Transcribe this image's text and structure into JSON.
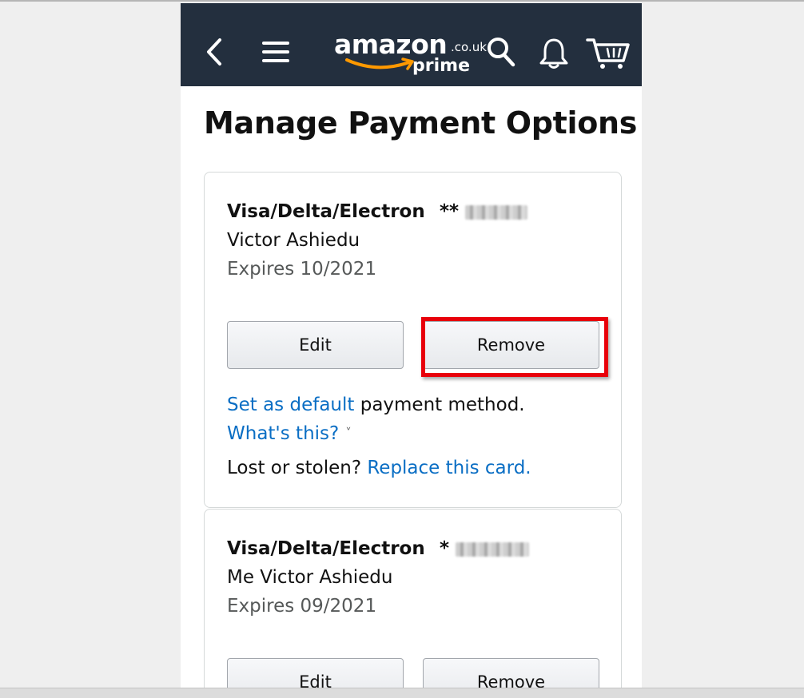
{
  "navbar": {
    "logo_word": "amazon",
    "logo_tld": ".co.uk",
    "logo_sub": "prime"
  },
  "page": {
    "title": "Manage Payment Options"
  },
  "cards": [
    {
      "type": "Visa/Delta/Electron",
      "mask": "**",
      "holder": "Victor Ashiedu",
      "expiry": "Expires 10/2021",
      "edit_label": "Edit",
      "remove_label": "Remove",
      "set_default_link": "Set as default",
      "set_default_rest": " payment method.",
      "whats_this_link": "What's this?",
      "lost_text": "Lost or stolen? ",
      "replace_link": "Replace this card."
    },
    {
      "type": "Visa/Delta/Electron",
      "mask": "*",
      "holder": "Me Victor Ashiedu",
      "expiry": "Expires 09/2021",
      "edit_label": "Edit",
      "remove_label": "Remove"
    }
  ],
  "colors": {
    "navbar_bg": "#232f3e",
    "link": "#0a6ec4",
    "highlight": "#e8000a",
    "smile": "#ff9900"
  },
  "icons": [
    "back-arrow-icon",
    "menu-icon",
    "search-icon",
    "bell-icon",
    "cart-icon"
  ]
}
